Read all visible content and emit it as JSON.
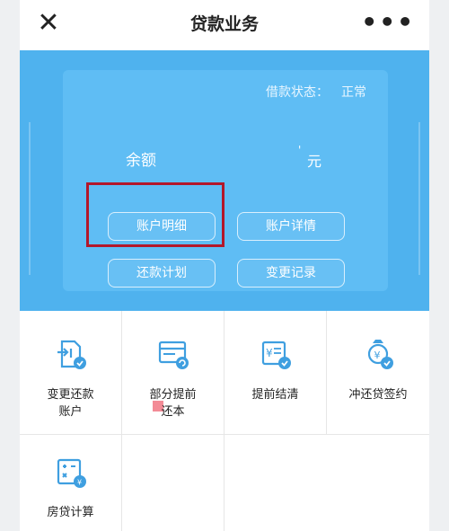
{
  "nav": {
    "close_icon": "close-icon",
    "title": "贷款业务",
    "more_label": "•••"
  },
  "card": {
    "status_label": "借款状态：",
    "status_value": "正常",
    "balance_label": "余额",
    "balance_value": "'",
    "balance_unit": "元",
    "buttons": {
      "detail": "账户明细",
      "info": "账户详情",
      "plan": "还款计划",
      "record": "变更记录"
    }
  },
  "grid": [
    {
      "label": "变更还款\n账户",
      "icon": "account-change-icon"
    },
    {
      "label": "部分提前\n还本",
      "icon": "partial-repay-icon"
    },
    {
      "label": "提前结清",
      "icon": "settle-icon"
    },
    {
      "label": "冲还贷签约",
      "icon": "loan-sign-icon"
    },
    {
      "label": "房贷计算",
      "icon": "calculator-icon"
    }
  ],
  "colors": {
    "banner": "#4fb2ee",
    "card": "#5fbdf4",
    "icon_blue": "#3f9fe0",
    "highlight": "#b3172a"
  }
}
